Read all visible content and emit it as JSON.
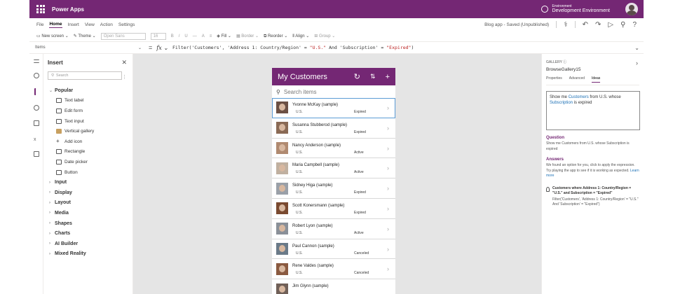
{
  "app": {
    "name": "Power Apps"
  },
  "environment": {
    "label": "Environment",
    "name": "Development Environment"
  },
  "menu": [
    "File",
    "Home",
    "Insert",
    "View",
    "Action",
    "Settings"
  ],
  "menu_active": "Home",
  "saved_status": "Blog app - Saved (Unpublished)",
  "ribbon": {
    "new_screen": "New screen",
    "theme": "Theme",
    "font": "Open Sans",
    "font_size": "16",
    "fill": "Fill",
    "border": "Border",
    "reorder": "Reorder",
    "align": "Align",
    "group": "Group"
  },
  "formula": {
    "property": "Items",
    "fx": "fx",
    "parts": [
      "Filter('Customers', 'Address 1: Country/Region' = ",
      "\"U.S.\"",
      " And 'Subscription' = ",
      "\"Expired\"",
      ")"
    ]
  },
  "insert_panel": {
    "title": "Insert",
    "search_placeholder": "Search",
    "popular_label": "Popular",
    "popular": [
      "Text label",
      "Edit form",
      "Text input",
      "Vertical gallery",
      "Add icon",
      "Rectangle",
      "Date picker",
      "Button"
    ],
    "categories": [
      "Input",
      "Display",
      "Layout",
      "Media",
      "Shapes",
      "Charts",
      "AI Builder",
      "Mixed Reality"
    ]
  },
  "phone": {
    "title": "My Customers",
    "search_placeholder": "Search items",
    "rows": [
      {
        "name": "Yvonne McKay (sample)",
        "country": "U.S.",
        "status": "Expired"
      },
      {
        "name": "Susanna Stubberod (sample)",
        "country": "U.S.",
        "status": "Expired"
      },
      {
        "name": "Nancy Anderson (sample)",
        "country": "U.S.",
        "status": "Active"
      },
      {
        "name": "Maria Campbell (sample)",
        "country": "U.S.",
        "status": "Active"
      },
      {
        "name": "Sidney Higa (sample)",
        "country": "U.S.",
        "status": "Expired"
      },
      {
        "name": "Scott Konersmann (sample)",
        "country": "U.S.",
        "status": "Expired"
      },
      {
        "name": "Robert Lyon (sample)",
        "country": "U.S.",
        "status": "Active"
      },
      {
        "name": "Paul Cannon (sample)",
        "country": "U.S.",
        "status": "Canceled"
      },
      {
        "name": "Rene Valdes (sample)",
        "country": "U.S.",
        "status": "Canceled"
      },
      {
        "name": "Jim Glynn (sample)",
        "country": "",
        "status": ""
      }
    ]
  },
  "right_panel": {
    "type_label": "GALLERY",
    "name": "BrowseGallery15",
    "tabs": [
      "Properties",
      "Advanced",
      "Ideas"
    ],
    "active_tab": "Ideas",
    "query_parts": [
      "Show me ",
      "Customers",
      " from U.S. whose ",
      "Subscription",
      " is expired"
    ],
    "question_title": "Question",
    "question_text": "Show me Customers from U.S. whose Subscription is expired",
    "answers_title": "Answers",
    "answers_text": "We found an option for you, click to apply the expression. Try playing the app to see if it is working as expected.",
    "learn_more": "Learn more",
    "suggestion_line1": "Customers where Address 1: Country/Region =",
    "suggestion_line2": "\"U.S.\" and Subscription = \"Expired\"",
    "suggestion_code": "Filter('Customers', 'Address 1: Country/Region' = \"U.S.\" And 'Subscription' = \"Expired\")"
  }
}
